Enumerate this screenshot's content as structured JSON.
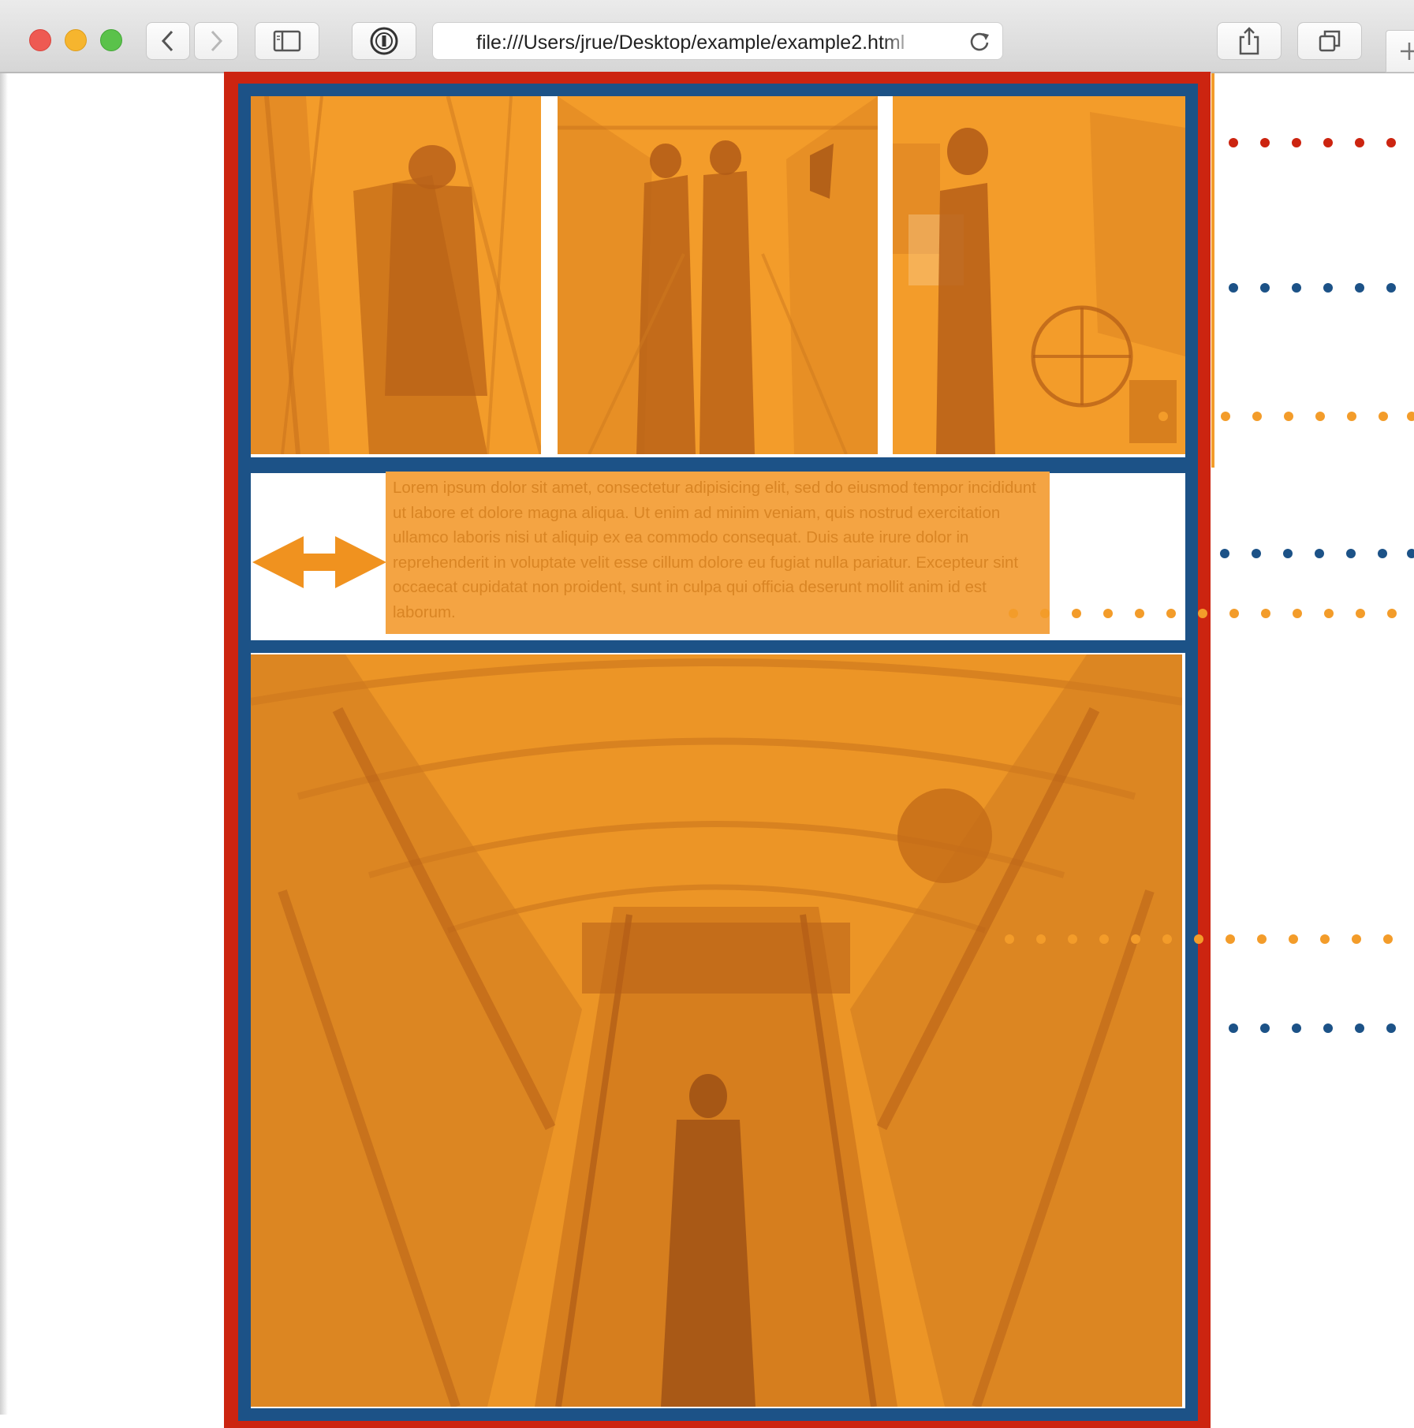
{
  "browser": {
    "url": "file:///Users/jrue/Desktop/example/example2.html",
    "icons": [
      "close-light",
      "minimize-light",
      "zoom-light",
      "back-icon",
      "forward-icon",
      "sidebar-icon",
      "reader-icon",
      "reload-icon",
      "share-icon",
      "tabs-icon",
      "new-tab-icon"
    ]
  },
  "content": {
    "body_text": "Lorem ipsum dolor sit amet, consectetur adipisicing elit, sed do eiusmod tempor incididunt ut labore et dolore magna aliqua. Ut enim ad minim veniam, quis nostrud exercitation ullamco laboris nisi ut aliquip ex ea commodo consequat. Duis aute irure dolor in reprehenderit in voluptate velit esse cillum dolore eu fugiat nulla pariatur. Excepteur sint occaecat cupidatat non proident, sunt in culpa qui officia deserunt mollit anim id est laborum."
  },
  "colors": {
    "page_container_outline": "#cc2410",
    "row_outline": "#1c5287",
    "image_overlay": "#f39c2a",
    "arrow": "#f0921f"
  }
}
